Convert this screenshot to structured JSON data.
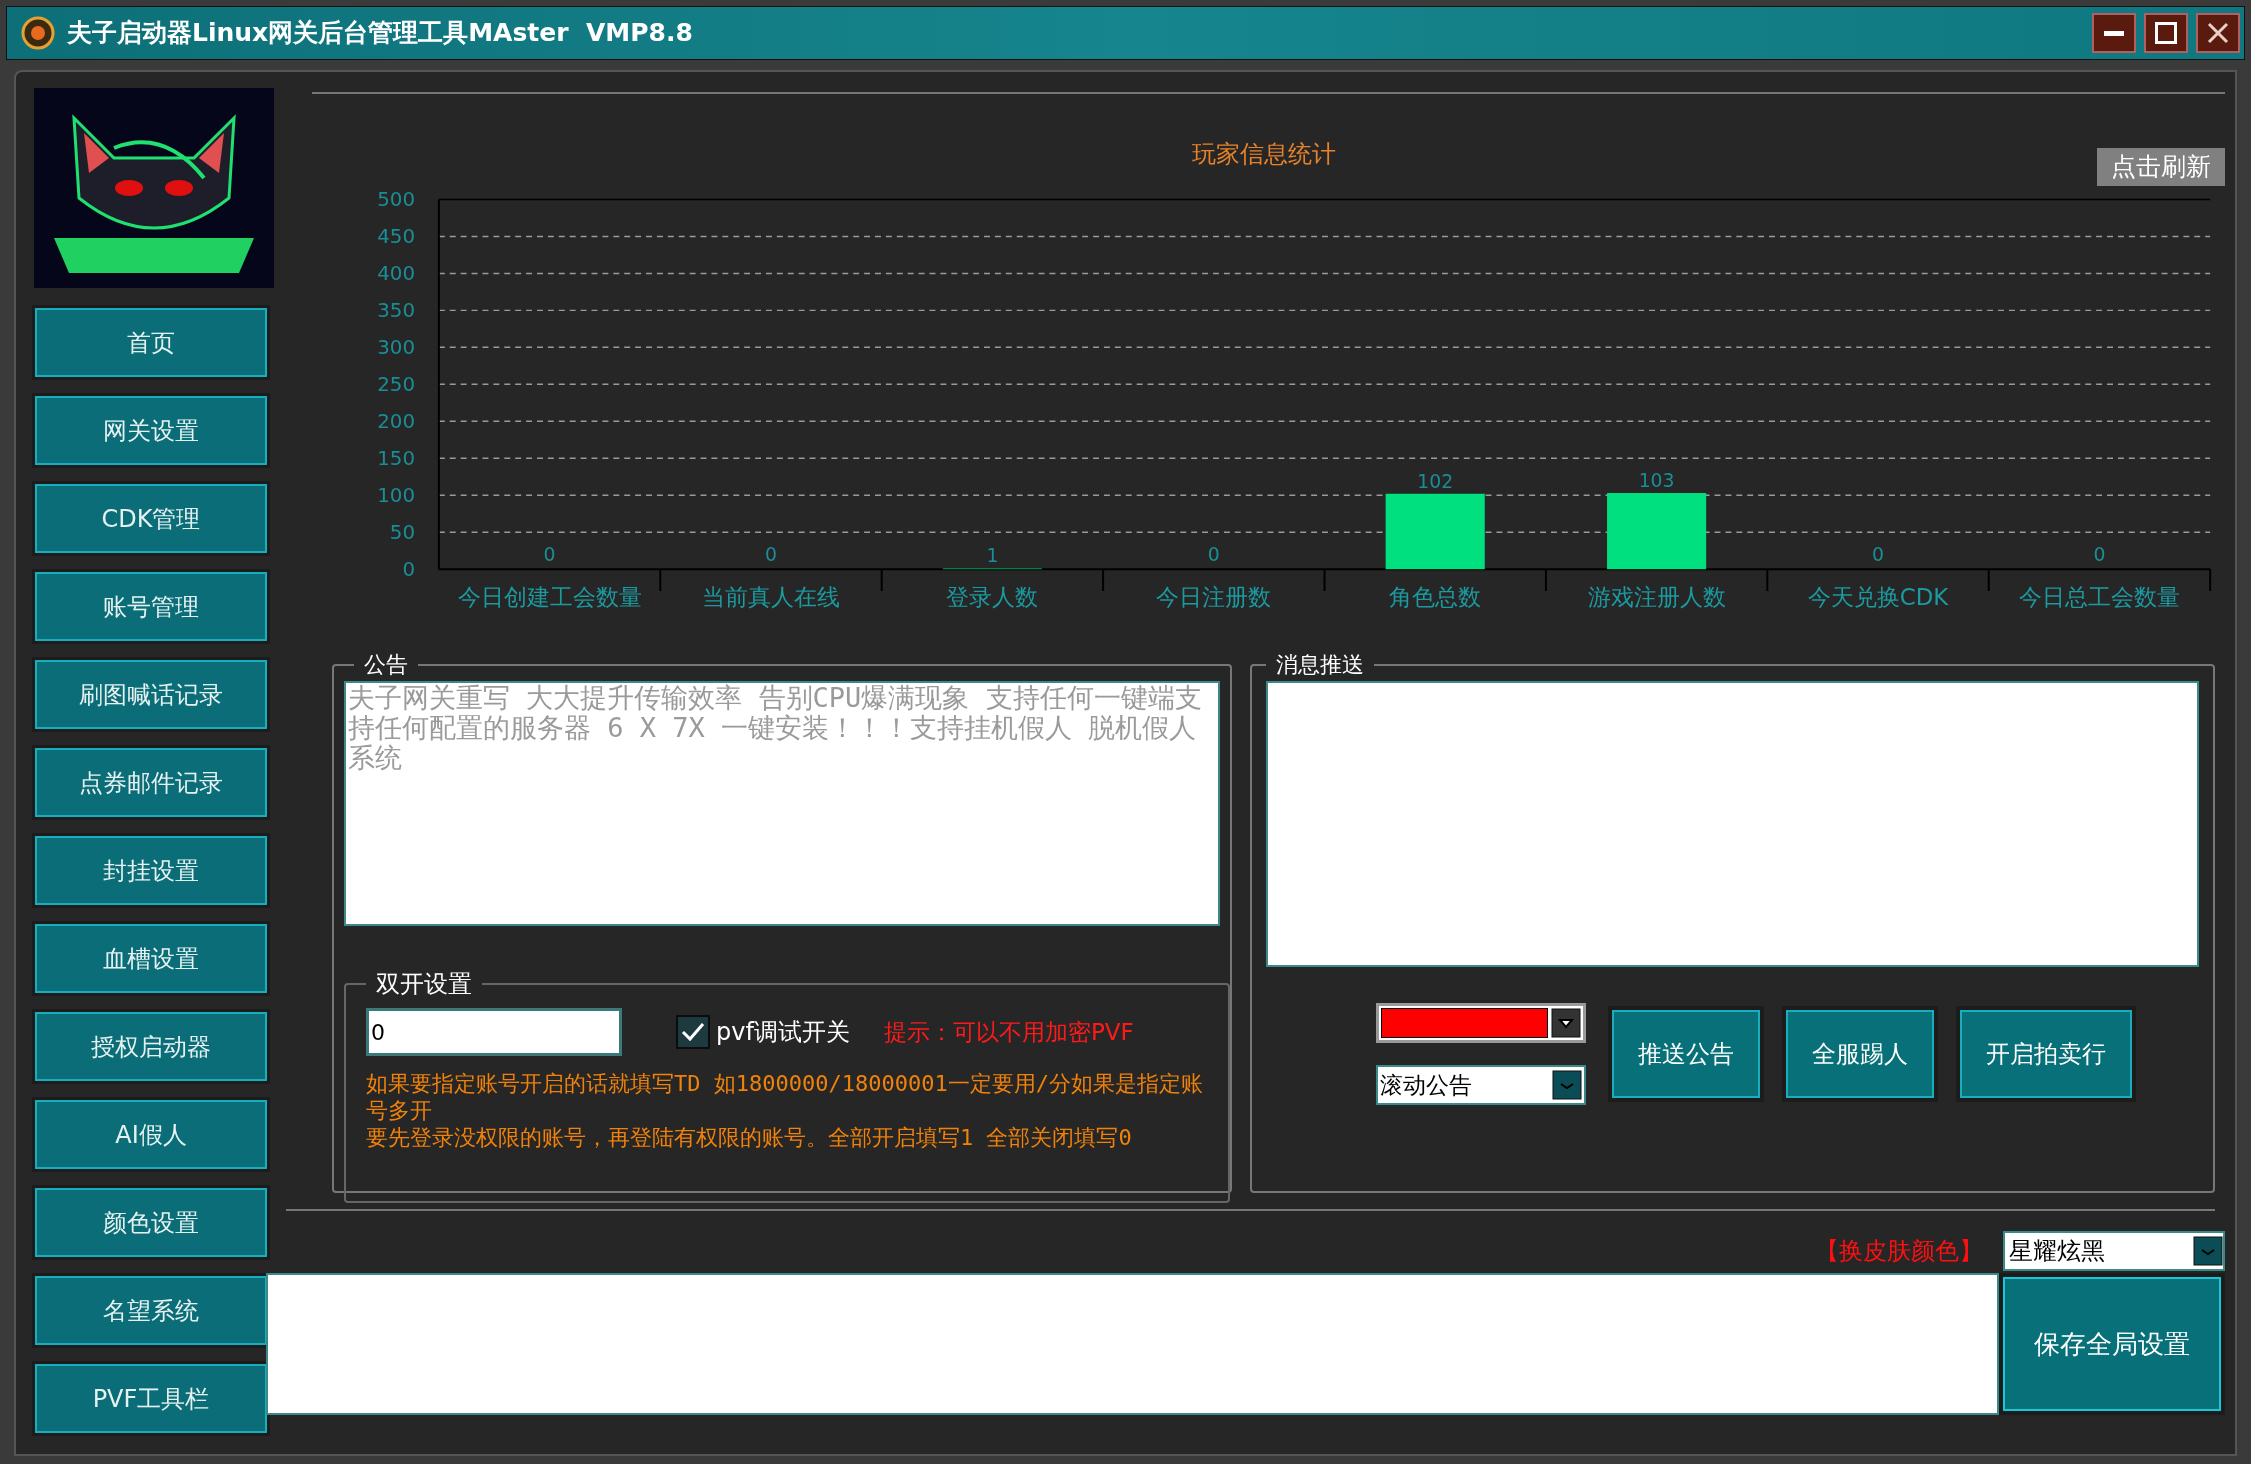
{
  "window": {
    "title": "夫子启动器Linux网关后台管理工具MAster  VMP8.8"
  },
  "sidebar": {
    "items": [
      {
        "label": "首页"
      },
      {
        "label": "网关设置"
      },
      {
        "label": "CDK管理"
      },
      {
        "label": "账号管理"
      },
      {
        "label": "刷图喊话记录"
      },
      {
        "label": "点券邮件记录"
      },
      {
        "label": "封挂设置"
      },
      {
        "label": "血槽设置"
      },
      {
        "label": "授权启动器"
      },
      {
        "label": "AI假人"
      },
      {
        "label": "颜色设置"
      },
      {
        "label": "名望系统"
      },
      {
        "label": "PVF工具栏"
      }
    ]
  },
  "stats": {
    "refresh_button": "点击刷新",
    "chart_data": {
      "type": "bar",
      "title": "玩家信息统计",
      "categories": [
        "今日创建工会数量",
        "当前真人在线",
        "登录人数",
        "今日注册数",
        "角色总数",
        "游戏注册人数",
        "今天兑换CDK",
        "今日总工会数量"
      ],
      "series": [
        {
          "color": "#00e07f",
          "values": [
            0,
            0,
            1,
            0,
            102,
            103,
            0,
            0
          ]
        }
      ],
      "grid": true,
      "ylim": [
        0,
        500
      ],
      "yticks": [
        0,
        50,
        100,
        150,
        200,
        250,
        300,
        350,
        400,
        450,
        500
      ],
      "data_labels": true
    }
  },
  "announcement": {
    "label": "公告",
    "text": "夫子网关重写 大大提升传输效率 告别CPU爆满现象 支持任何一键端支持任何配置的服务器 6 X 7X 一键安装！！！支持挂机假人 脱机假人系统"
  },
  "dual_open": {
    "label": "双开设置",
    "value": "0",
    "pvf_debug": {
      "label": "pvf调试开关",
      "checked": true
    },
    "hint": "提示：可以不用加密PVF",
    "notes": [
      "如果要指定账号开启的话就填写TD 如1800000/18000001一定要用/分如果是指定账号多开",
      "要先登录没权限的账号，再登陆有权限的账号。全部开启填写1 全部关闭填写0"
    ]
  },
  "message_push": {
    "label": "消息推送",
    "color_select": {
      "color": "#ff0000"
    },
    "type_select": "滚动公告",
    "buttons": [
      "推送公告",
      "全服踢人",
      "开启拍卖行"
    ]
  },
  "skin": {
    "label": "【换皮肤颜色】",
    "value": "星耀炫黑"
  },
  "save_button": "保存全局设置"
}
